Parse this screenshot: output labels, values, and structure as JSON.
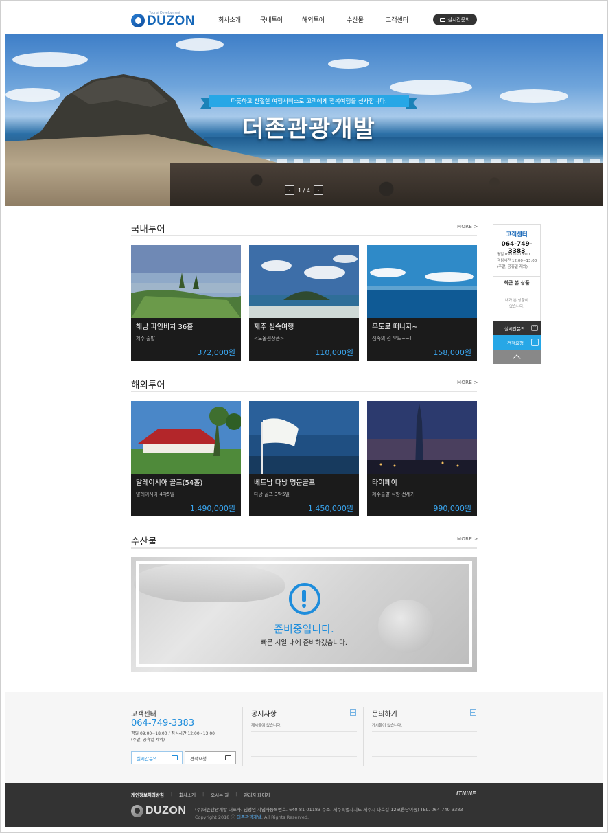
{
  "header": {
    "logo_text": "DUZON",
    "logo_sub": "Tourist Development",
    "nav": [
      "회사소개",
      "국내투어",
      "해외투어",
      "수산물",
      "고객센터"
    ],
    "live_chat_label": "실시간문의"
  },
  "hero": {
    "ribbon_text": "따뜻하고 친절한 여행서비스로 고객에게 행복여행을 선사합니다.",
    "title": "더존관광개발",
    "pager": "1 / 4",
    "prev": "‹",
    "next": "›"
  },
  "domestic": {
    "title": "국내투어",
    "more": "MORE  >",
    "cards": [
      {
        "title": "해남 파인비치 36홀",
        "sub": "제주 출발",
        "price": "372,000원"
      },
      {
        "title": "제주 실속여행",
        "sub": "<노옵션상품>",
        "price": "110,000원"
      },
      {
        "title": "우도로 떠나자~",
        "sub": "섬속의 섬 우도~~!",
        "price": "158,000원"
      }
    ]
  },
  "overseas": {
    "title": "해외투어",
    "more": "MORE  >",
    "cards": [
      {
        "title": "말레이시아 골프(54홀)",
        "sub": "말레이시아 4박5일",
        "price": "1,490,000원"
      },
      {
        "title": "베트남 다낭 명문골프",
        "sub": "다낭 골프 3박5일",
        "price": "1,450,000원"
      },
      {
        "title": "타이페이",
        "sub": "제주출발 직항 전세기",
        "price": "990,000원"
      }
    ]
  },
  "seafood": {
    "title": "수산물",
    "more": "MORE  >",
    "prep_title": "준비중입니다.",
    "prep_sub": "빠른 시일 내에 준비하겠습니다."
  },
  "quick_menu": {
    "title": "고객센터",
    "phone": "064-749-3383",
    "hours_1": "평일 09:00~18:00",
    "hours_2": "점심시간 12:00~13:00",
    "hours_3": "(주말, 공휴일 제외)",
    "recent_title": "최근 본 상품",
    "recent_empty_1": "내가 본 상품이",
    "recent_empty_2": "없습니다.",
    "live_label": "실시간문의",
    "quote_label": "견적요청"
  },
  "footer_info": {
    "cs_title": "고객센터",
    "cs_phone": "064-749-3383",
    "cs_hours_1": "평일 09:00~18:00 / 점심시간 12:00~13:00",
    "cs_hours_2": "(주말, 공휴일 제외)",
    "live_btn": "실시간문의",
    "quote_btn": "견적요청",
    "notice_title": "공지사항",
    "notice_empty": "게시물이 없습니다.",
    "inquiry_title": "문의하기",
    "inquiry_empty": "게시물이 없습니다.",
    "plus": "+"
  },
  "footer": {
    "links": [
      "개인정보처리방침",
      "회사소개",
      "오시는 길",
      "관리자 페이지"
    ],
    "separator": "|",
    "partner_logo": "ITNINE",
    "address": "(주)더존관광개발    대표자. 임정인    사업자등록번호. 640-81-01183    주소. 제주특별자치도 제주시 다호길 126(용담이동)    TEL. 064-749-3383",
    "copy_prefix": "Copyright 2018 ⓒ ",
    "copy_company": "더존관광개발",
    "copy_suffix": ". All Rights Reserved."
  },
  "colors": {
    "accent": "#27a7e6",
    "brand": "#1667b8",
    "price": "#3aa6f0",
    "dark": "#333333"
  }
}
